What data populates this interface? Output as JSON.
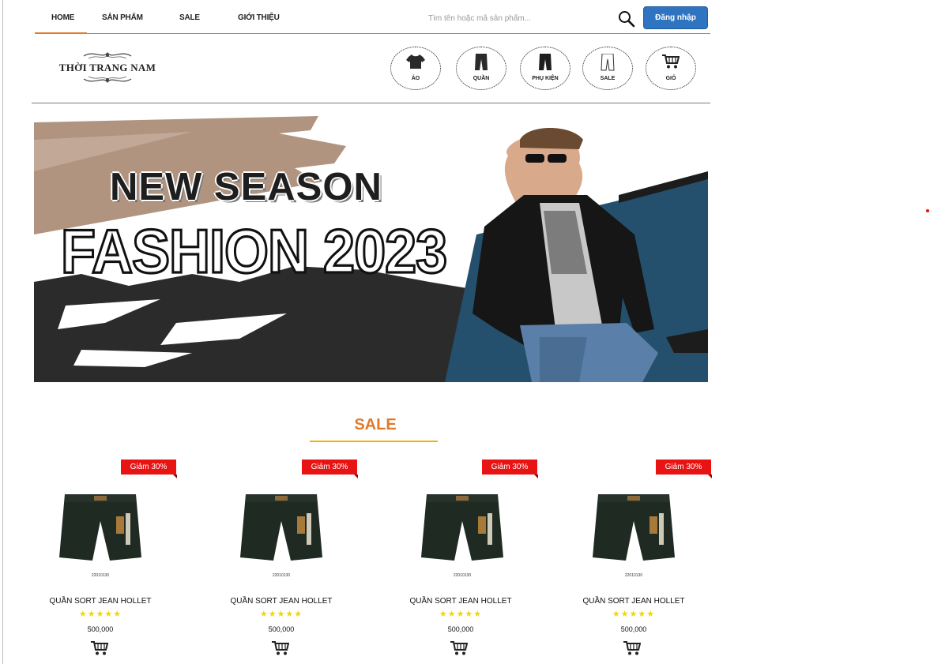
{
  "nav": {
    "items": [
      {
        "label": "HOME"
      },
      {
        "label": "SẢN PHẨM"
      },
      {
        "label": "SALE"
      },
      {
        "label": "GIỚI THIỆU"
      }
    ],
    "search_placeholder": "Tìm tên hoặc mã sản phẩm...",
    "login_label": "Đăng nhập",
    "accent_color": "#e07a2b",
    "login_color": "#2f74c0"
  },
  "header": {
    "logo_text": "THỜI TRANG NAM",
    "categories": [
      {
        "label": "ÁO",
        "icon": "shirt-icon"
      },
      {
        "label": "QUẦN",
        "icon": "pants-icon"
      },
      {
        "label": "PHỤ KIỆN",
        "icon": "accessory-pants-icon"
      },
      {
        "label": "SALE",
        "icon": "sale-pants-icon"
      },
      {
        "label": "GIỎ",
        "icon": "cart-icon"
      }
    ]
  },
  "banner": {
    "line1": "NEW SEASON",
    "line2": "FASHION 2023"
  },
  "sale": {
    "title": "SALE",
    "products": [
      {
        "badge": "Giảm 30%",
        "name": "QUẦN SORT JEAN HOLLET",
        "rating": 5,
        "stars": "★★★★★",
        "price": "500,000",
        "code": "22010130"
      },
      {
        "badge": "Giảm 30%",
        "name": "QUẦN SORT JEAN HOLLET",
        "rating": 5,
        "stars": "★★★★★",
        "price": "500,000",
        "code": "22010130"
      },
      {
        "badge": "Giảm 30%",
        "name": "QUẦN SORT JEAN HOLLET",
        "rating": 5,
        "stars": "★★★★★",
        "price": "500,000",
        "code": "22010130"
      },
      {
        "badge": "Giảm 30%",
        "name": "QUẦN SORT JEAN HOLLET",
        "rating": 5,
        "stars": "★★★★★",
        "price": "500,000",
        "code": "22010130"
      }
    ]
  }
}
